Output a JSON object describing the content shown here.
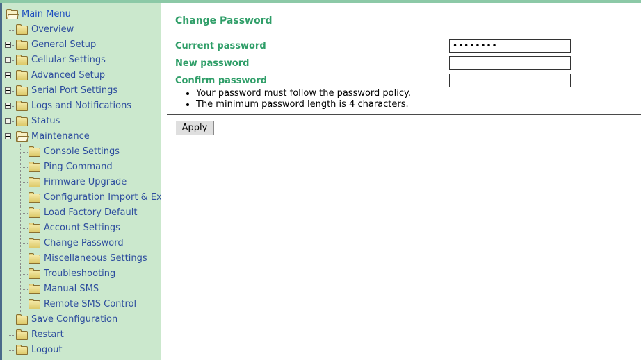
{
  "theme": {
    "sidebar_bg": "#cbe8cd",
    "top_strip": "#8cc9a7",
    "link_color": "#2e4e9e",
    "heading_color": "#2f9e68",
    "sidebar_border": "#4a6a8a"
  },
  "sidebar": {
    "root": {
      "label": "Main Menu",
      "icon": "open-folder-icon",
      "expanded": true
    },
    "items": [
      {
        "label": "Overview",
        "icon": "folder-icon",
        "level": 1,
        "toggle": "none"
      },
      {
        "label": "General Setup",
        "icon": "folder-icon",
        "level": 1,
        "toggle": "plus"
      },
      {
        "label": "Cellular Settings",
        "icon": "folder-icon",
        "level": 1,
        "toggle": "plus"
      },
      {
        "label": "Advanced Setup",
        "icon": "folder-icon",
        "level": 1,
        "toggle": "plus"
      },
      {
        "label": "Serial Port Settings",
        "icon": "folder-icon",
        "level": 1,
        "toggle": "plus"
      },
      {
        "label": "Logs and Notifications",
        "icon": "folder-icon",
        "level": 1,
        "toggle": "plus"
      },
      {
        "label": "Status",
        "icon": "folder-icon",
        "level": 1,
        "toggle": "plus"
      },
      {
        "label": "Maintenance",
        "icon": "open-folder-icon",
        "level": 1,
        "toggle": "minus"
      },
      {
        "label": "Console Settings",
        "icon": "folder-icon",
        "level": 2,
        "toggle": "none"
      },
      {
        "label": "Ping Command",
        "icon": "folder-icon",
        "level": 2,
        "toggle": "none"
      },
      {
        "label": "Firmware Upgrade",
        "icon": "folder-icon",
        "level": 2,
        "toggle": "none"
      },
      {
        "label": "Configuration Import & Export",
        "icon": "folder-icon",
        "level": 2,
        "toggle": "none"
      },
      {
        "label": "Load Factory Default",
        "icon": "folder-icon",
        "level": 2,
        "toggle": "none"
      },
      {
        "label": "Account Settings",
        "icon": "folder-icon",
        "level": 2,
        "toggle": "none"
      },
      {
        "label": "Change Password",
        "icon": "folder-icon",
        "level": 2,
        "toggle": "none",
        "selected": true
      },
      {
        "label": "Miscellaneous Settings",
        "icon": "folder-icon",
        "level": 2,
        "toggle": "none"
      },
      {
        "label": "Troubleshooting",
        "icon": "folder-icon",
        "level": 2,
        "toggle": "none"
      },
      {
        "label": "Manual SMS",
        "icon": "folder-icon",
        "level": 2,
        "toggle": "none"
      },
      {
        "label": "Remote SMS Control",
        "icon": "folder-icon",
        "level": 2,
        "toggle": "none"
      },
      {
        "label": "Save Configuration",
        "icon": "folder-icon",
        "level": 1,
        "toggle": "none"
      },
      {
        "label": "Restart",
        "icon": "folder-icon",
        "level": 1,
        "toggle": "none"
      },
      {
        "label": "Logout",
        "icon": "folder-icon",
        "level": 1,
        "toggle": "none"
      }
    ]
  },
  "main": {
    "title": "Change Password",
    "fields": [
      {
        "label": "Current password",
        "value": "servicex",
        "placeholder": "",
        "type": "password"
      },
      {
        "label": "New password",
        "value": "",
        "placeholder": "",
        "type": "password"
      },
      {
        "label": "Confirm password",
        "value": "",
        "placeholder": "",
        "type": "password"
      }
    ],
    "hints": [
      "Your password must follow the password policy.",
      "The minimum password length is 4 characters."
    ],
    "apply_label": "Apply"
  }
}
